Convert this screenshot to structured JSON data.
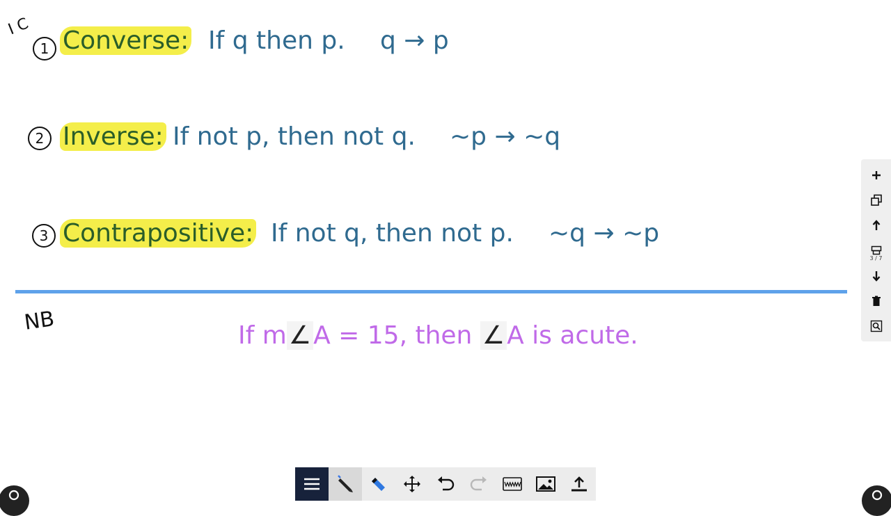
{
  "handwriting": {
    "ic": "I C",
    "nb": "NB"
  },
  "statements": [
    {
      "number": "1",
      "term": "Converse:",
      "text": "If q then p.",
      "symbol": "q → p"
    },
    {
      "number": "2",
      "term": "Inverse:",
      "text": "If not p, then not q.",
      "symbol": "~p → ~q"
    },
    {
      "number": "3",
      "term": "Contrapositive:",
      "text": "If not q, then not p.",
      "symbol": "~q → ~p"
    }
  ],
  "note": {
    "before": "If m",
    "angle1": "∠",
    "mid": "A = 15, then ",
    "angle2": "∠",
    "after": "A is acute."
  },
  "sidebar": {
    "page_indicator": "3 / 7"
  },
  "colors": {
    "text_blue": "#2f6a8f",
    "highlight": "#f4ee4a",
    "term_green": "#2b5e29",
    "divider": "#5ea2ea",
    "note_purple": "#c06ae8"
  }
}
